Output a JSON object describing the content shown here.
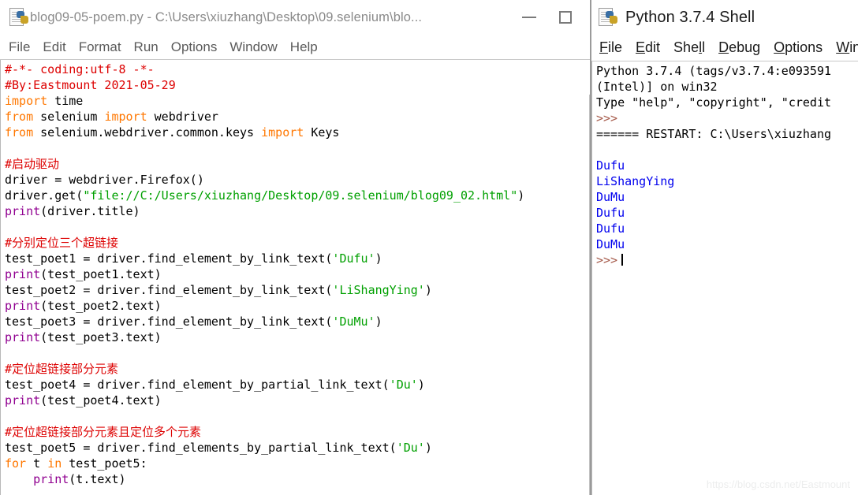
{
  "editor": {
    "title": "blog09-05-poem.py - C:\\Users\\xiuzhang\\Desktop\\09.selenium\\blo...",
    "icon": "python-file-icon",
    "window_buttons": {
      "minimize": "minimize-button",
      "maximize": "maximize-button"
    },
    "menu": [
      "File",
      "Edit",
      "Format",
      "Run",
      "Options",
      "Window",
      "Help"
    ],
    "code_lines": [
      [
        {
          "t": "#-*- coding:utf-8 -*-",
          "c": "c-com"
        }
      ],
      [
        {
          "t": "#By:Eastmount 2021-05-29",
          "c": "c-com"
        }
      ],
      [
        {
          "t": "import",
          "c": "c-key"
        },
        {
          "t": " time",
          "c": "c-plain"
        }
      ],
      [
        {
          "t": "from",
          "c": "c-key"
        },
        {
          "t": " selenium ",
          "c": "c-plain"
        },
        {
          "t": "import",
          "c": "c-key"
        },
        {
          "t": " webdriver",
          "c": "c-plain"
        }
      ],
      [
        {
          "t": "from",
          "c": "c-key"
        },
        {
          "t": " selenium.webdriver.common.keys ",
          "c": "c-plain"
        },
        {
          "t": "import",
          "c": "c-key"
        },
        {
          "t": " Keys",
          "c": "c-plain"
        }
      ],
      [
        {
          "t": "",
          "c": "c-plain"
        }
      ],
      [
        {
          "t": "#启动驱动",
          "c": "c-com"
        }
      ],
      [
        {
          "t": "driver = webdriver.Firefox()",
          "c": "c-plain"
        }
      ],
      [
        {
          "t": "driver.get(",
          "c": "c-plain"
        },
        {
          "t": "\"file://C:/Users/xiuzhang/Desktop/09.selenium/blog09_02.html\"",
          "c": "c-str"
        },
        {
          "t": ")",
          "c": "c-plain"
        }
      ],
      [
        {
          "t": "print",
          "c": "c-bi"
        },
        {
          "t": "(driver.title)",
          "c": "c-plain"
        }
      ],
      [
        {
          "t": "",
          "c": "c-plain"
        }
      ],
      [
        {
          "t": "#分别定位三个超链接",
          "c": "c-com"
        }
      ],
      [
        {
          "t": "test_poet1 = driver.find_element_by_link_text(",
          "c": "c-plain"
        },
        {
          "t": "'Dufu'",
          "c": "c-str"
        },
        {
          "t": ")",
          "c": "c-plain"
        }
      ],
      [
        {
          "t": "print",
          "c": "c-bi"
        },
        {
          "t": "(test_poet1.text)",
          "c": "c-plain"
        }
      ],
      [
        {
          "t": "test_poet2 = driver.find_element_by_link_text(",
          "c": "c-plain"
        },
        {
          "t": "'LiShangYing'",
          "c": "c-str"
        },
        {
          "t": ")",
          "c": "c-plain"
        }
      ],
      [
        {
          "t": "print",
          "c": "c-bi"
        },
        {
          "t": "(test_poet2.text)",
          "c": "c-plain"
        }
      ],
      [
        {
          "t": "test_poet3 = driver.find_element_by_link_text(",
          "c": "c-plain"
        },
        {
          "t": "'DuMu'",
          "c": "c-str"
        },
        {
          "t": ")",
          "c": "c-plain"
        }
      ],
      [
        {
          "t": "print",
          "c": "c-bi"
        },
        {
          "t": "(test_poet3.text)",
          "c": "c-plain"
        }
      ],
      [
        {
          "t": "",
          "c": "c-plain"
        }
      ],
      [
        {
          "t": "#定位超链接部分元素",
          "c": "c-com"
        }
      ],
      [
        {
          "t": "test_poet4 = driver.find_element_by_partial_link_text(",
          "c": "c-plain"
        },
        {
          "t": "'Du'",
          "c": "c-str"
        },
        {
          "t": ")",
          "c": "c-plain"
        }
      ],
      [
        {
          "t": "print",
          "c": "c-bi"
        },
        {
          "t": "(test_poet4.text)",
          "c": "c-plain"
        }
      ],
      [
        {
          "t": "",
          "c": "c-plain"
        }
      ],
      [
        {
          "t": "#定位超链接部分元素且定位多个元素",
          "c": "c-com"
        }
      ],
      [
        {
          "t": "test_poet5 = driver.find_elements_by_partial_link_text(",
          "c": "c-plain"
        },
        {
          "t": "'Du'",
          "c": "c-str"
        },
        {
          "t": ")",
          "c": "c-plain"
        }
      ],
      [
        {
          "t": "for",
          "c": "c-key"
        },
        {
          "t": " t ",
          "c": "c-plain"
        },
        {
          "t": "in",
          "c": "c-key"
        },
        {
          "t": " test_poet5:",
          "c": "c-plain"
        }
      ],
      [
        {
          "t": "    ",
          "c": "c-plain"
        },
        {
          "t": "print",
          "c": "c-bi"
        },
        {
          "t": "(t.text)",
          "c": "c-plain"
        }
      ]
    ]
  },
  "shell": {
    "title": "Python 3.7.4 Shell",
    "icon": "python-shell-icon",
    "menu": [
      {
        "label": "File",
        "accel": "F"
      },
      {
        "label": "Edit",
        "accel": "E"
      },
      {
        "label": "Shell",
        "accel": "l"
      },
      {
        "label": "Debug",
        "accel": "D"
      },
      {
        "label": "Options",
        "accel": "O"
      },
      {
        "label": "Win",
        "accel": "W"
      }
    ],
    "lines": [
      [
        {
          "t": "Python 3.7.4 (tags/v3.7.4:e093591",
          "c": "s-plain"
        }
      ],
      [
        {
          "t": "(Intel)] on win32",
          "c": "s-plain"
        }
      ],
      [
        {
          "t": "Type \"help\", \"copyright\", \"credit",
          "c": "s-plain"
        }
      ],
      [
        {
          "t": ">>>",
          "c": "s-prompt"
        }
      ],
      [
        {
          "t": "====== RESTART: C:\\Users\\xiuzhang",
          "c": "s-plain"
        }
      ],
      [
        {
          "t": "",
          "c": "s-plain"
        }
      ],
      [
        {
          "t": "Dufu",
          "c": "s-out"
        }
      ],
      [
        {
          "t": "LiShangYing",
          "c": "s-out"
        }
      ],
      [
        {
          "t": "DuMu",
          "c": "s-out"
        }
      ],
      [
        {
          "t": "Dufu",
          "c": "s-out"
        }
      ],
      [
        {
          "t": "Dufu",
          "c": "s-out"
        }
      ],
      [
        {
          "t": "DuMu",
          "c": "s-out"
        }
      ],
      [
        {
          "t": ">>>",
          "c": "s-prompt",
          "caret": true
        }
      ]
    ]
  },
  "watermark": "https://blog.csdn.net/Eastmount",
  "colors": {
    "comment": "#dd0000",
    "keyword": "#ff7700",
    "string": "#00a000",
    "builtin": "#900090",
    "output": "#0000ee",
    "prompt": "#a55a4a"
  }
}
